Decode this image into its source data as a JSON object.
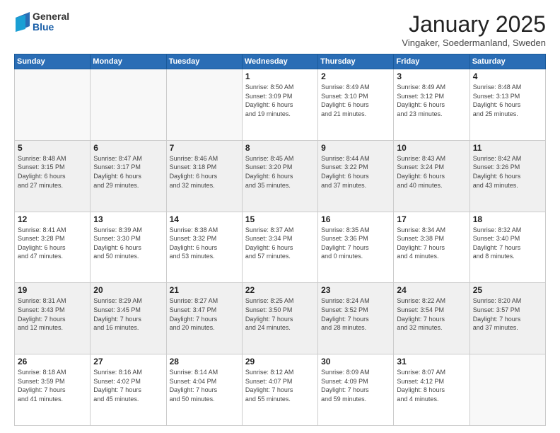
{
  "logo": {
    "general": "General",
    "blue": "Blue"
  },
  "header": {
    "month": "January 2025",
    "location": "Vingaker, Soedermanland, Sweden"
  },
  "weekdays": [
    "Sunday",
    "Monday",
    "Tuesday",
    "Wednesday",
    "Thursday",
    "Friday",
    "Saturday"
  ],
  "weeks": [
    {
      "shaded": false,
      "days": [
        {
          "num": "",
          "info": ""
        },
        {
          "num": "",
          "info": ""
        },
        {
          "num": "",
          "info": ""
        },
        {
          "num": "1",
          "info": "Sunrise: 8:50 AM\nSunset: 3:09 PM\nDaylight: 6 hours\nand 19 minutes."
        },
        {
          "num": "2",
          "info": "Sunrise: 8:49 AM\nSunset: 3:10 PM\nDaylight: 6 hours\nand 21 minutes."
        },
        {
          "num": "3",
          "info": "Sunrise: 8:49 AM\nSunset: 3:12 PM\nDaylight: 6 hours\nand 23 minutes."
        },
        {
          "num": "4",
          "info": "Sunrise: 8:48 AM\nSunset: 3:13 PM\nDaylight: 6 hours\nand 25 minutes."
        }
      ]
    },
    {
      "shaded": true,
      "days": [
        {
          "num": "5",
          "info": "Sunrise: 8:48 AM\nSunset: 3:15 PM\nDaylight: 6 hours\nand 27 minutes."
        },
        {
          "num": "6",
          "info": "Sunrise: 8:47 AM\nSunset: 3:17 PM\nDaylight: 6 hours\nand 29 minutes."
        },
        {
          "num": "7",
          "info": "Sunrise: 8:46 AM\nSunset: 3:18 PM\nDaylight: 6 hours\nand 32 minutes."
        },
        {
          "num": "8",
          "info": "Sunrise: 8:45 AM\nSunset: 3:20 PM\nDaylight: 6 hours\nand 35 minutes."
        },
        {
          "num": "9",
          "info": "Sunrise: 8:44 AM\nSunset: 3:22 PM\nDaylight: 6 hours\nand 37 minutes."
        },
        {
          "num": "10",
          "info": "Sunrise: 8:43 AM\nSunset: 3:24 PM\nDaylight: 6 hours\nand 40 minutes."
        },
        {
          "num": "11",
          "info": "Sunrise: 8:42 AM\nSunset: 3:26 PM\nDaylight: 6 hours\nand 43 minutes."
        }
      ]
    },
    {
      "shaded": false,
      "days": [
        {
          "num": "12",
          "info": "Sunrise: 8:41 AM\nSunset: 3:28 PM\nDaylight: 6 hours\nand 47 minutes."
        },
        {
          "num": "13",
          "info": "Sunrise: 8:39 AM\nSunset: 3:30 PM\nDaylight: 6 hours\nand 50 minutes."
        },
        {
          "num": "14",
          "info": "Sunrise: 8:38 AM\nSunset: 3:32 PM\nDaylight: 6 hours\nand 53 minutes."
        },
        {
          "num": "15",
          "info": "Sunrise: 8:37 AM\nSunset: 3:34 PM\nDaylight: 6 hours\nand 57 minutes."
        },
        {
          "num": "16",
          "info": "Sunrise: 8:35 AM\nSunset: 3:36 PM\nDaylight: 7 hours\nand 0 minutes."
        },
        {
          "num": "17",
          "info": "Sunrise: 8:34 AM\nSunset: 3:38 PM\nDaylight: 7 hours\nand 4 minutes."
        },
        {
          "num": "18",
          "info": "Sunrise: 8:32 AM\nSunset: 3:40 PM\nDaylight: 7 hours\nand 8 minutes."
        }
      ]
    },
    {
      "shaded": true,
      "days": [
        {
          "num": "19",
          "info": "Sunrise: 8:31 AM\nSunset: 3:43 PM\nDaylight: 7 hours\nand 12 minutes."
        },
        {
          "num": "20",
          "info": "Sunrise: 8:29 AM\nSunset: 3:45 PM\nDaylight: 7 hours\nand 16 minutes."
        },
        {
          "num": "21",
          "info": "Sunrise: 8:27 AM\nSunset: 3:47 PM\nDaylight: 7 hours\nand 20 minutes."
        },
        {
          "num": "22",
          "info": "Sunrise: 8:25 AM\nSunset: 3:50 PM\nDaylight: 7 hours\nand 24 minutes."
        },
        {
          "num": "23",
          "info": "Sunrise: 8:24 AM\nSunset: 3:52 PM\nDaylight: 7 hours\nand 28 minutes."
        },
        {
          "num": "24",
          "info": "Sunrise: 8:22 AM\nSunset: 3:54 PM\nDaylight: 7 hours\nand 32 minutes."
        },
        {
          "num": "25",
          "info": "Sunrise: 8:20 AM\nSunset: 3:57 PM\nDaylight: 7 hours\nand 37 minutes."
        }
      ]
    },
    {
      "shaded": false,
      "days": [
        {
          "num": "26",
          "info": "Sunrise: 8:18 AM\nSunset: 3:59 PM\nDaylight: 7 hours\nand 41 minutes."
        },
        {
          "num": "27",
          "info": "Sunrise: 8:16 AM\nSunset: 4:02 PM\nDaylight: 7 hours\nand 45 minutes."
        },
        {
          "num": "28",
          "info": "Sunrise: 8:14 AM\nSunset: 4:04 PM\nDaylight: 7 hours\nand 50 minutes."
        },
        {
          "num": "29",
          "info": "Sunrise: 8:12 AM\nSunset: 4:07 PM\nDaylight: 7 hours\nand 55 minutes."
        },
        {
          "num": "30",
          "info": "Sunrise: 8:09 AM\nSunset: 4:09 PM\nDaylight: 7 hours\nand 59 minutes."
        },
        {
          "num": "31",
          "info": "Sunrise: 8:07 AM\nSunset: 4:12 PM\nDaylight: 8 hours\nand 4 minutes."
        },
        {
          "num": "",
          "info": ""
        }
      ]
    }
  ]
}
